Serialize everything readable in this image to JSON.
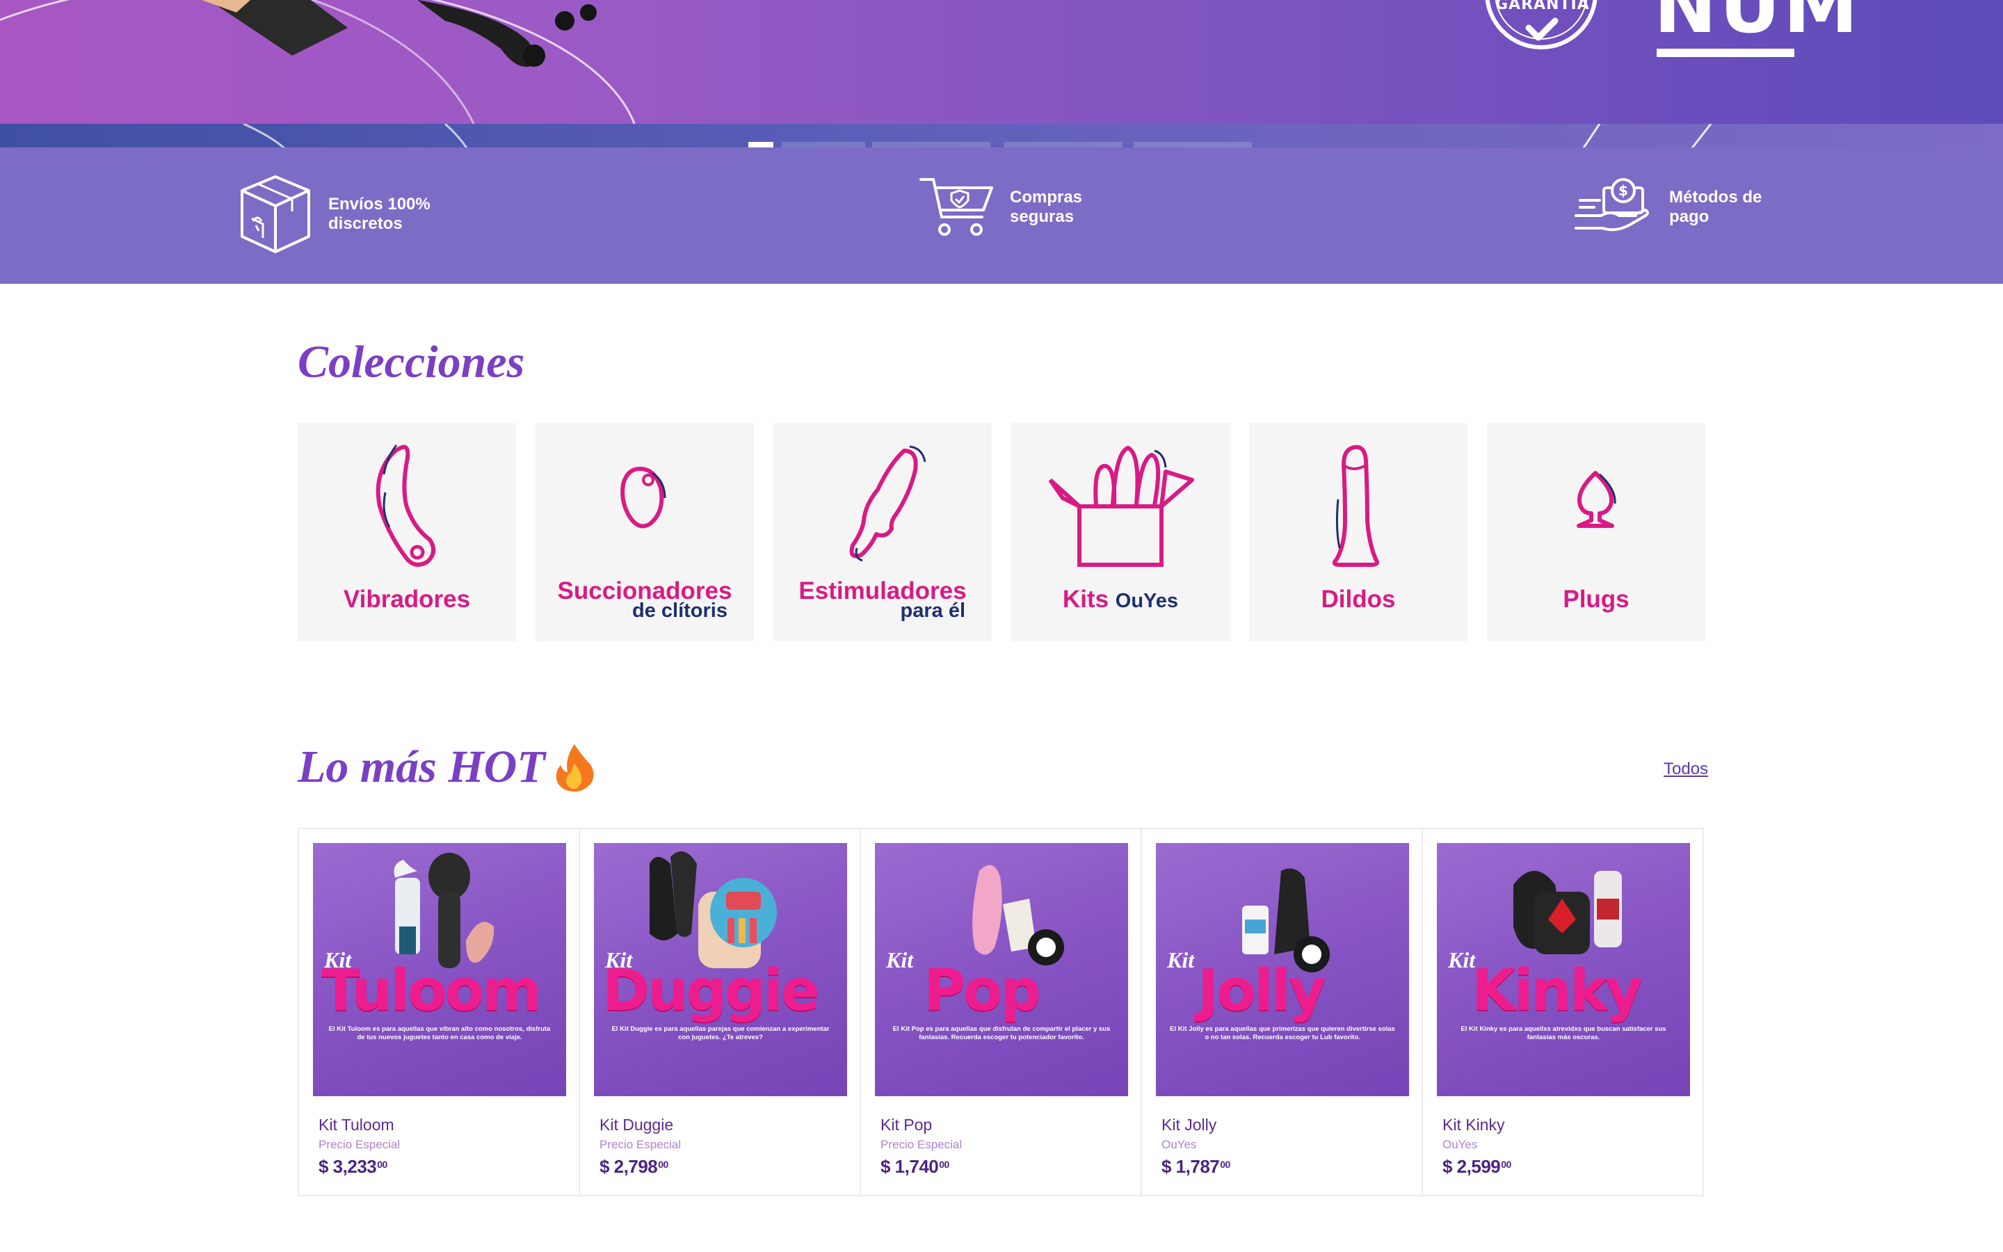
{
  "hero": {
    "seal_text": "GARANTIA",
    "logo_text": "NUM",
    "slides": 5,
    "active_slide": 1
  },
  "benefits": [
    {
      "icon": "box-icon",
      "text": "Envíos 100% discretos"
    },
    {
      "icon": "cart-shield-icon",
      "text": "Compras seguras"
    },
    {
      "icon": "payment-hand-icon",
      "text": "Métodos de pago"
    }
  ],
  "collections": {
    "title": "Colecciones",
    "items": [
      {
        "label": "Vibradores",
        "sub": "",
        "icon": "vibrator-icon"
      },
      {
        "label": "Succionadores",
        "sub": "de clítoris",
        "icon": "suction-icon"
      },
      {
        "label": "Estimuladores",
        "sub": "para él",
        "icon": "stimulator-icon"
      },
      {
        "label": "Kits",
        "sub": "OuYes",
        "icon": "kit-box-icon"
      },
      {
        "label": "Dildos",
        "sub": "",
        "icon": "dildo-icon"
      },
      {
        "label": "Plugs",
        "sub": "",
        "icon": "plug-icon"
      }
    ]
  },
  "hot": {
    "title": "Lo más HOT",
    "emoji": "🔥",
    "all_link": "Todos",
    "products": [
      {
        "img_kit": "Kit",
        "img_name": "Tuloom",
        "img_desc": "El Kit Tuloom es para aquellas que vibran alto como nosotros, disfruta de tus nuevos juguetes tanto en casa como de viaje.",
        "name": "Kit Tuloom",
        "sub": "Precio Especial",
        "price": "$ 3,233",
        "cents": "00"
      },
      {
        "img_kit": "Kit",
        "img_name": "Duggie",
        "img_desc": "El Kit Duggie es para aquellas parejas que comienzan a experimentar con juguetes. ¿Te atreves?",
        "name": "Kit Duggie",
        "sub": "Precio Especial",
        "price": "$ 2,798",
        "cents": "00"
      },
      {
        "img_kit": "Kit",
        "img_name": "Pop",
        "img_desc": "El Kit Pop es para aquellas que disfrutan de compartir el placer y sus fantasías. Recuerda escoger tu potenciador favorito.",
        "name": "Kit Pop",
        "sub": "Precio Especial",
        "price": "$ 1,740",
        "cents": "00"
      },
      {
        "img_kit": "Kit",
        "img_name": "Jolly",
        "img_desc": "El Kit Jolly es para aquellas que primerizas que quieren divertirse solas o no tan solas. Recuerda escoger tu Lub favorito.",
        "name": "Kit Jolly",
        "sub": "OuYes",
        "price": "$ 1,787",
        "cents": "00"
      },
      {
        "img_kit": "Kit",
        "img_name": "Kinky",
        "img_desc": "El Kit Kinky es para aquellxs atrevidxs que buscan satisfacer sus fantasías más oscuras.",
        "name": "Kit Kinky",
        "sub": "OuYes",
        "price": "$ 2,599",
        "cents": "00"
      }
    ]
  },
  "colors": {
    "brand_purple": "#7b3fc4",
    "pink": "#d91a84",
    "navy": "#1f2f6e",
    "benefits_bg": "#7c6cc5"
  }
}
